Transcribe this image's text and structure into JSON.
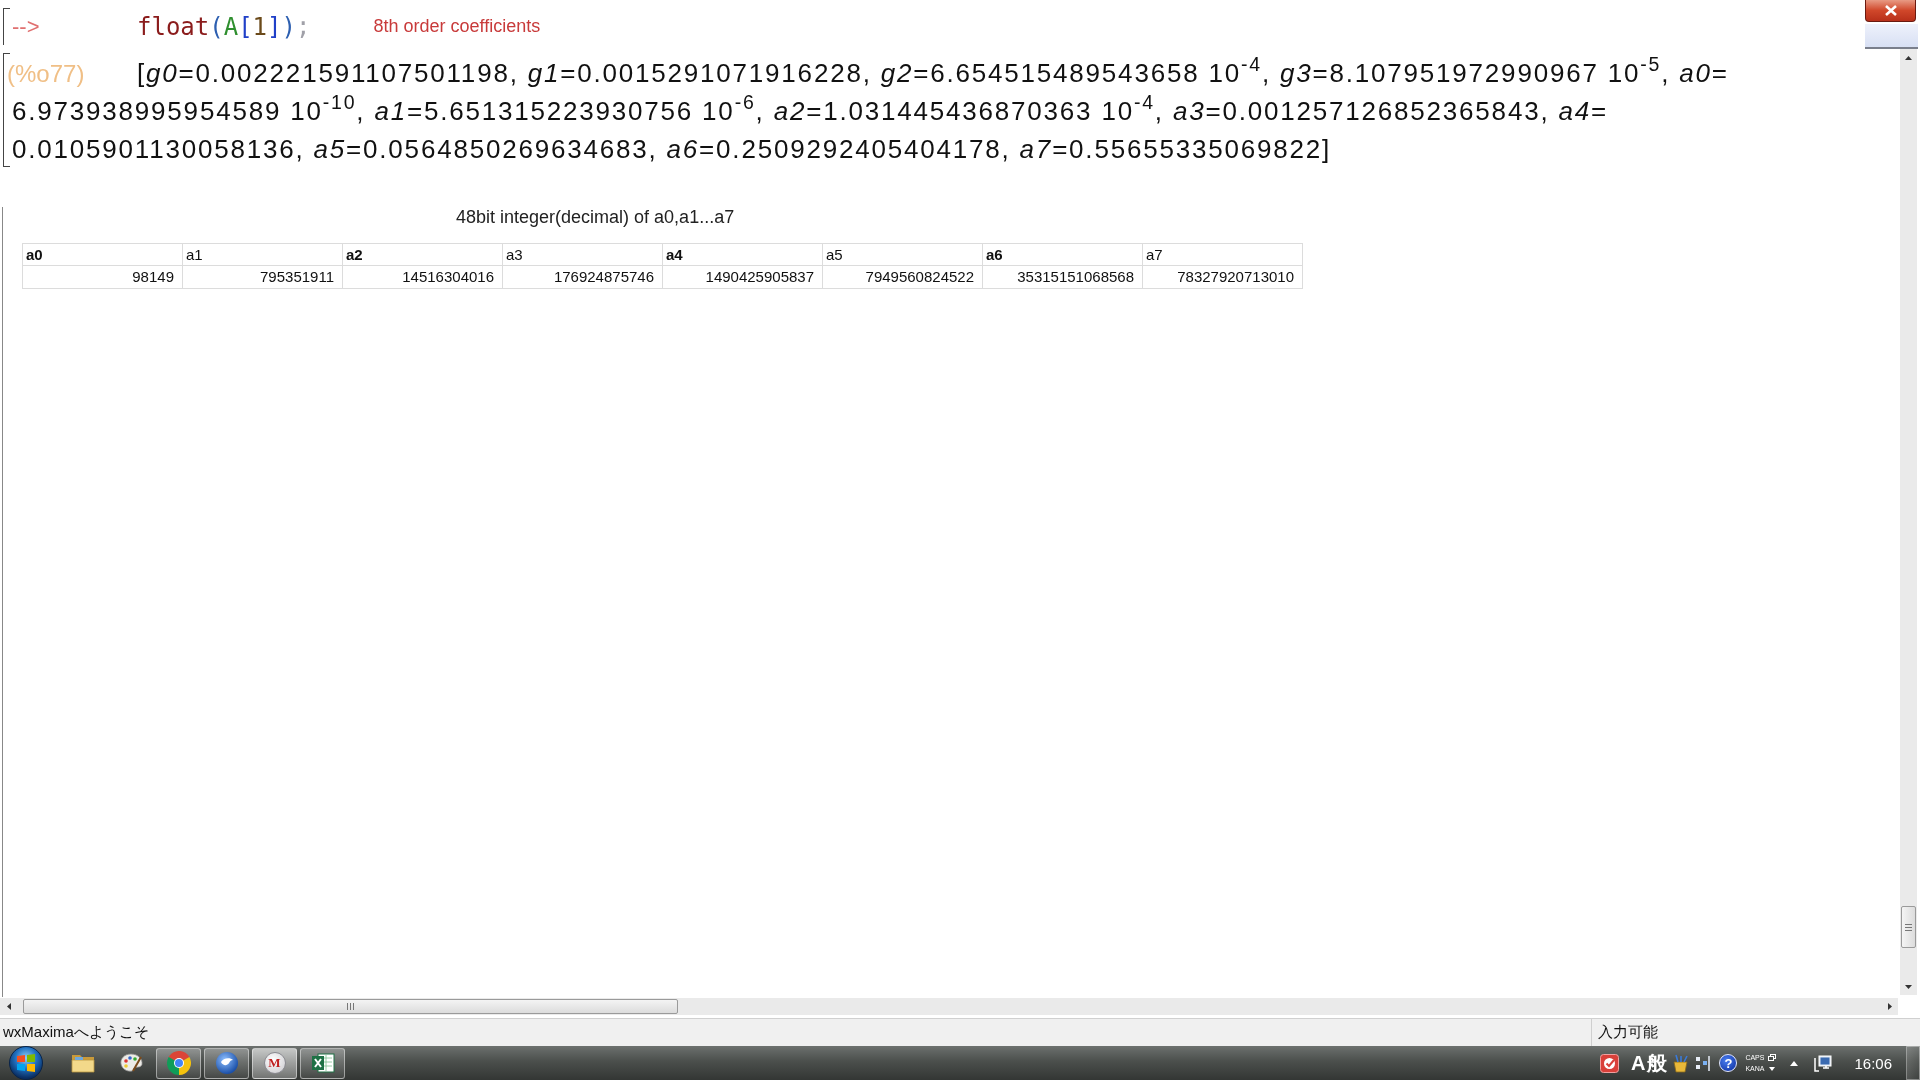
{
  "input_cell": {
    "prompt": "-->",
    "code": [
      {
        "text": "float",
        "kind": "function"
      },
      {
        "text": "(",
        "kind": "paren"
      },
      {
        "text": "A",
        "kind": "variable"
      },
      {
        "text": "[",
        "kind": "bracket"
      },
      {
        "text": "1",
        "kind": "number"
      },
      {
        "text": "]",
        "kind": "bracket"
      },
      {
        "text": ")",
        "kind": "paren"
      },
      {
        "text": ";",
        "kind": "end"
      }
    ],
    "comment": "8th order coefficients"
  },
  "output_cell": {
    "label": "(%o77)",
    "lines": [
      "[*g0*=0.002221591107501198, *g1*=0.0015291071916228, *g2*=6.654515489543658 10$^{-4}$, *g3*=8.107951972990967 10$^{-5}$, *a0*=",
      "6.973938995954589 10$^{-10}$, *a1*=5.651315223930756 10$^{-6}$, *a2*=1.031445436870363 10$^{-4}$, *a3*=0.001257126852365843, *a4*=",
      "0.0105901130058136, *a5*=0.0564850269634683, *a6*=0.2509292405404178, *a7*=0.55655335069822]"
    ]
  },
  "table_cell": {
    "title": "48bit integer(decimal) of a0,a1...a7",
    "columns": [
      {
        "label": "a0",
        "bold": true
      },
      {
        "label": "a1",
        "bold": false
      },
      {
        "label": "a2",
        "bold": true
      },
      {
        "label": "a3",
        "bold": false
      },
      {
        "label": "a4",
        "bold": true
      },
      {
        "label": "a5",
        "bold": false
      },
      {
        "label": "a6",
        "bold": true
      },
      {
        "label": "a7",
        "bold": false
      }
    ],
    "rows": [
      [
        "98149",
        "795351911",
        "14516304016",
        "176924875746",
        "1490425905837",
        "7949560824522",
        "35315151068568",
        "78327920713010"
      ]
    ]
  },
  "status_bar": {
    "message": "wxMaximaへようこそ",
    "state": "入力可能"
  },
  "taskbar": {
    "apps": [
      {
        "kind": "folder",
        "open": false,
        "selected": false
      },
      {
        "kind": "palette",
        "open": false,
        "selected": false
      },
      {
        "kind": "browser",
        "open": true,
        "selected": false
      },
      {
        "kind": "sphere",
        "open": true,
        "selected": false
      },
      {
        "kind": "maxima",
        "open": true,
        "selected": true,
        "glyph": "M"
      },
      {
        "kind": "spreadsheet",
        "open": true,
        "selected": false
      }
    ],
    "tray": {
      "ime": [
        "A",
        "般"
      ],
      "help": "?",
      "caps": "CAPS",
      "kana": "KANA",
      "clock": "16:06"
    }
  }
}
